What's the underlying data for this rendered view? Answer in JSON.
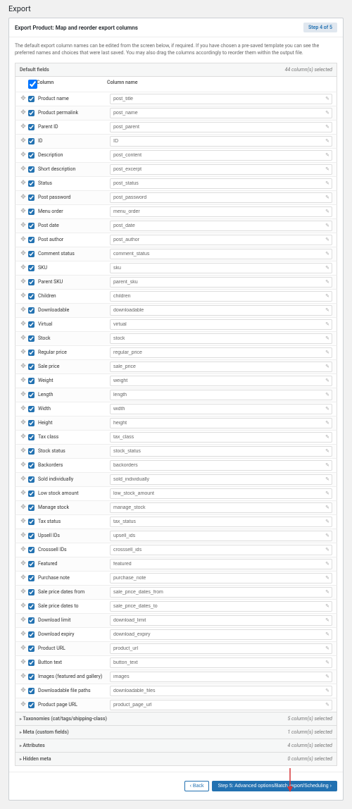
{
  "page_title": "Export",
  "panel_title": "Export Product: Map and reorder export columns",
  "step_badge": "Step 4 of 5",
  "description": "The default export column names can be edited from the screen below, if required. If you have chosen a pre-saved template you can see the preferred names and choices that were last saved. You may also drag the columns accordingly to reorder them within the output file.",
  "section": {
    "label": "Default fields",
    "count": "44 column(s) selected"
  },
  "table_head": {
    "col": "Column",
    "name": "Column name"
  },
  "rows": [
    {
      "label": "Product name",
      "value": "post_title"
    },
    {
      "label": "Product permalink",
      "value": "post_name"
    },
    {
      "label": "Parent ID",
      "value": "post_parent"
    },
    {
      "label": "ID",
      "value": "ID"
    },
    {
      "label": "Description",
      "value": "post_content"
    },
    {
      "label": "Short description",
      "value": "post_excerpt"
    },
    {
      "label": "Status",
      "value": "post_status"
    },
    {
      "label": "Post password",
      "value": "post_password"
    },
    {
      "label": "Menu order",
      "value": "menu_order"
    },
    {
      "label": "Post date",
      "value": "post_date"
    },
    {
      "label": "Post author",
      "value": "post_author"
    },
    {
      "label": "Comment status",
      "value": "comment_status"
    },
    {
      "label": "SKU",
      "value": "sku"
    },
    {
      "label": "Parent SKU",
      "value": "parent_sku"
    },
    {
      "label": "Children",
      "value": "children"
    },
    {
      "label": "Downloadable",
      "value": "downloadable"
    },
    {
      "label": "Virtual",
      "value": "virtual"
    },
    {
      "label": "Stock",
      "value": "stock"
    },
    {
      "label": "Regular price",
      "value": "regular_price"
    },
    {
      "label": "Sale price",
      "value": "sale_price"
    },
    {
      "label": "Weight",
      "value": "weight"
    },
    {
      "label": "Length",
      "value": "length"
    },
    {
      "label": "Width",
      "value": "width"
    },
    {
      "label": "Height",
      "value": "height"
    },
    {
      "label": "Tax class",
      "value": "tax_class"
    },
    {
      "label": "Stock status",
      "value": "stock_status"
    },
    {
      "label": "Backorders",
      "value": "backorders"
    },
    {
      "label": "Sold individually",
      "value": "sold_individually"
    },
    {
      "label": "Low stock amount",
      "value": "low_stock_amount"
    },
    {
      "label": "Manage stock",
      "value": "manage_stock"
    },
    {
      "label": "Tax status",
      "value": "tax_status"
    },
    {
      "label": "Upsell IDs",
      "value": "upsell_ids"
    },
    {
      "label": "Crosssell IDs",
      "value": "crosssell_ids"
    },
    {
      "label": "Featured",
      "value": "featured"
    },
    {
      "label": "Purchase note",
      "value": "purchase_note"
    },
    {
      "label": "Sale price dates from",
      "value": "sale_price_dates_from"
    },
    {
      "label": "Sale price dates to",
      "value": "sale_price_dates_to"
    },
    {
      "label": "Download limit",
      "value": "download_limit"
    },
    {
      "label": "Download expiry",
      "value": "download_expiry"
    },
    {
      "label": "Product URL",
      "value": "product_url"
    },
    {
      "label": "Button text",
      "value": "button_text"
    },
    {
      "label": "Images (featured and gallery)",
      "value": "images"
    },
    {
      "label": "Downloadable file paths",
      "value": "downloadable_files"
    },
    {
      "label": "Product page URL",
      "value": "product_page_url"
    }
  ],
  "accordions": [
    {
      "label": "Taxonomies (cat/tags/shipping-class)",
      "count": "5 column(s) selected"
    },
    {
      "label": "Meta (custom fields)",
      "count": "1 column(s) selected"
    },
    {
      "label": "Attributes",
      "count": "4 column(s) selected"
    },
    {
      "label": "Hidden meta",
      "count": "0 column(s) selected"
    }
  ],
  "footer": {
    "back": "Back",
    "next": "Step 5: Advanced options/Batch export/Scheduling"
  }
}
